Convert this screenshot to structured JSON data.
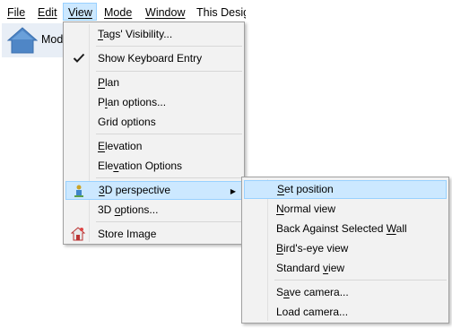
{
  "menubar": {
    "items": [
      {
        "key": "F",
        "rest": "ile"
      },
      {
        "key": "E",
        "rest": "dit"
      },
      {
        "key": "V",
        "rest": "iew"
      },
      {
        "key": "M",
        "rest": "ode"
      },
      {
        "key": "W",
        "rest": "indow"
      },
      {
        "key": "",
        "rest": "This Desig"
      }
    ]
  },
  "toolbar": {
    "label": "Mod",
    "icon": "home-icon"
  },
  "view_menu": {
    "tags_visibility": {
      "u": "T",
      "a": "ags' Visibility..."
    },
    "show_keyboard_entry": {
      "label": "Show Keyboard Entry",
      "checked": true
    },
    "plan": {
      "u": "P",
      "a": "lan"
    },
    "plan_options": {
      "a": "P",
      "u": "l",
      "b": "an options..."
    },
    "grid_options": {
      "label": "Grid options"
    },
    "elevation": {
      "u": "E",
      "a": "levation"
    },
    "elevation_options": {
      "a": "Ele",
      "u": "v",
      "b": "ation Options"
    },
    "perspective_3d": {
      "u": "3",
      "a": "D perspective",
      "icon": "perspective-icon"
    },
    "options_3d": {
      "a": "3D ",
      "u": "o",
      "b": "ptions..."
    },
    "store_image": {
      "label": "Store Image",
      "icon": "store-image-icon"
    }
  },
  "camera_menu": {
    "set_position": {
      "u": "S",
      "a": "et position"
    },
    "normal_view": {
      "u": "N",
      "a": "ormal view"
    },
    "back_against_wall": {
      "a": "Back Against Selected ",
      "u": "W",
      "b": "all"
    },
    "birds_eye_view": {
      "u": "B",
      "a": "ird's-eye view"
    },
    "standard_view": {
      "a": "Standard ",
      "u": "v",
      "b": "iew"
    },
    "save_camera": {
      "a": "S",
      "u": "a",
      "b": "ve camera..."
    },
    "load_camera": {
      "label": "Load camera..."
    }
  },
  "colors": {
    "highlight": "#cce8ff",
    "highlight_border": "#99d1ff",
    "menu_bg": "#f2f2f2"
  }
}
